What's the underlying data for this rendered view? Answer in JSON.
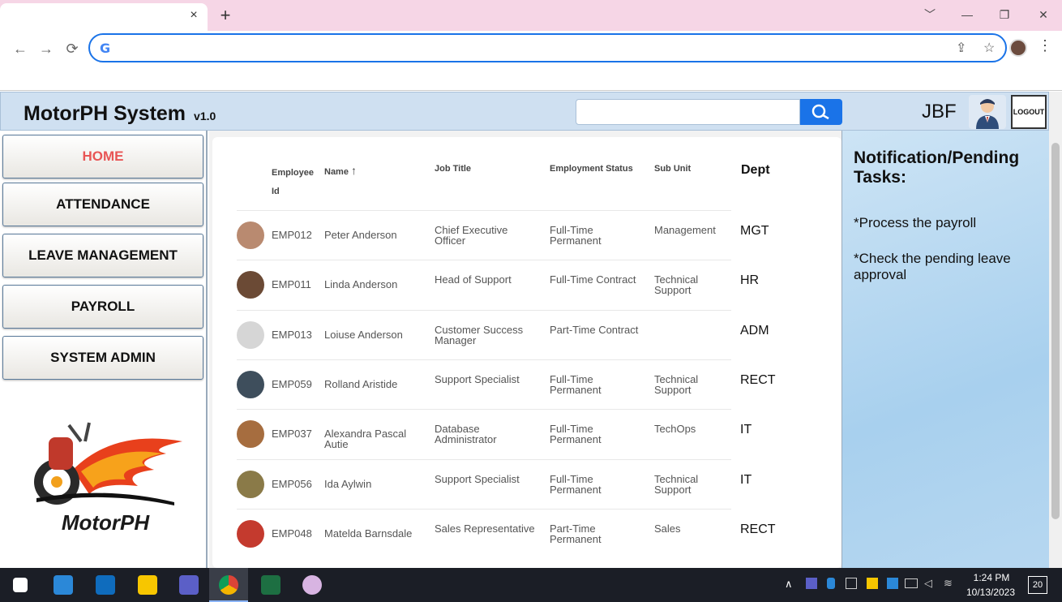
{
  "browser": {
    "tab_close": "×",
    "new_tab": "+",
    "window_controls": [
      "﹀",
      "—",
      "❐",
      "✕"
    ],
    "omnibox_value": ""
  },
  "app": {
    "title": "MotorPH System",
    "version": "v1.0",
    "search_placeholder": "",
    "user": "JBF",
    "logout_label": "LOGOUT"
  },
  "sidebar": {
    "items": [
      {
        "label": "HOME",
        "active": true
      },
      {
        "label": "ATTENDANCE"
      },
      {
        "label": "LEAVE MANAGEMENT"
      },
      {
        "label": "PAYROLL"
      },
      {
        "label": "SYSTEM ADMIN"
      }
    ],
    "logo_text": "MotorPH"
  },
  "table": {
    "headers": {
      "employee_id": "Employee Id",
      "name": "Name",
      "job_title": "Job Title",
      "employment_status": "Employment Status",
      "sub_unit": "Sub Unit",
      "dept": "Dept"
    },
    "sort_indicator": "↑",
    "rows": [
      {
        "id": "EMP012",
        "name": "Peter Anderson",
        "title": "Chief Executive Officer",
        "status": "Full-Time Permanent",
        "unit": "Management",
        "dept": "MGT",
        "photo": "#b98a70"
      },
      {
        "id": "EMP011",
        "name": "Linda Anderson",
        "title": "Head of Support",
        "status": "Full-Time Contract",
        "unit": "Technical Support",
        "dept": "HR",
        "photo": "#6b4a35"
      },
      {
        "id": "EMP013",
        "name": "Loiuse Anderson",
        "title": "Customer Success Manager",
        "status": "Part-Time Contract",
        "unit": "",
        "dept": "ADM",
        "photo": "#d6d6d6"
      },
      {
        "id": "EMP059",
        "name": "Rolland Aristide",
        "title": "Support Specialist",
        "status": "Full-Time Permanent",
        "unit": "Technical Support",
        "dept": "RECT",
        "photo": "#3e4e5c"
      },
      {
        "id": "EMP037",
        "name": "Alexandra Pascal Autie",
        "title": "Database Administrator",
        "status": "Full-Time Permanent",
        "unit": "TechOps",
        "dept": "IT",
        "photo": "#a66d3f"
      },
      {
        "id": "EMP056",
        "name": "Ida Aylwin",
        "title": "Support Specialist",
        "status": "Full-Time Permanent",
        "unit": "Technical Support",
        "dept": "IT",
        "photo": "#8a7a48"
      },
      {
        "id": "EMP048",
        "name": "Matelda Barnsdale",
        "title": "Sales Representative",
        "status": "Part-Time Permanent",
        "unit": "Sales",
        "dept": "RECT",
        "photo": "#c43a2e"
      }
    ]
  },
  "notifications": {
    "title": "Notification/Pending Tasks:",
    "tasks": [
      "*Process the payroll",
      "*Check the pending leave approval"
    ]
  },
  "taskbar": {
    "time": "1:24 PM",
    "date": "10/13/2023",
    "badge": "20"
  }
}
